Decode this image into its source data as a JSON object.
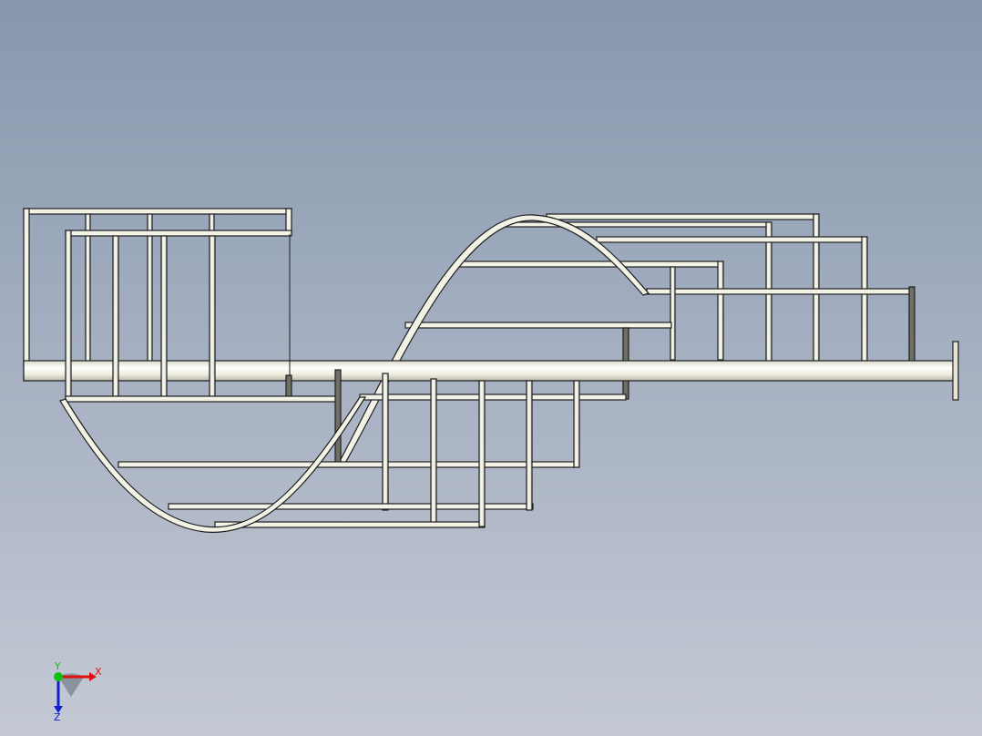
{
  "view": {
    "background_top": "#8797ad",
    "background_bottom": "#c4c9d4",
    "part_fill": "#f3f2e6",
    "part_edge": "#1e1e1e",
    "shaft_highlight": "#ffffff",
    "shaft_shade": "#c9c8b8"
  },
  "triad": {
    "x_label": "X",
    "y_label": "Y",
    "z_label": "Z",
    "x_color": "#e01010",
    "y_color": "#10c010",
    "z_color": "#1020d0"
  }
}
